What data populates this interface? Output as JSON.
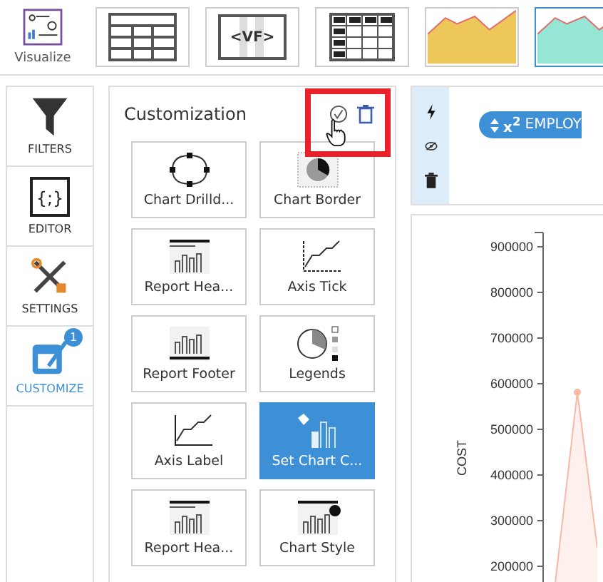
{
  "toolbar": {
    "visualize_label": "Visualize",
    "thumbnails": [
      {
        "kind": "table",
        "selected": false
      },
      {
        "kind": "vf",
        "text": "<VF>",
        "selected": false
      },
      {
        "kind": "grid",
        "selected": false
      },
      {
        "kind": "area",
        "color": "#eec75a",
        "selected": false
      },
      {
        "kind": "area",
        "color": "#96e6d6",
        "selected": true
      }
    ]
  },
  "sidebar": {
    "items": [
      {
        "kind": "filter",
        "label": "FILTERS",
        "selected": false
      },
      {
        "kind": "editor",
        "label": "EDITOR",
        "icon_text": "{;}",
        "selected": false
      },
      {
        "kind": "settings",
        "label": "SETTINGS",
        "selected": false
      },
      {
        "kind": "customize",
        "label": "CUSTOMIZE",
        "selected": true,
        "badge": "1"
      }
    ]
  },
  "customization": {
    "title": "Customization",
    "tiles": [
      {
        "kind": "drilldown",
        "label": "Chart Drilld...",
        "selected": false
      },
      {
        "kind": "border",
        "label": "Chart Border",
        "selected": false
      },
      {
        "kind": "report-header",
        "label": "Report Hea...",
        "selected": false
      },
      {
        "kind": "axis-tick",
        "label": "Axis Tick",
        "selected": false
      },
      {
        "kind": "report-footer",
        "label": "Report Footer",
        "selected": false
      },
      {
        "kind": "legends",
        "label": "Legends",
        "selected": false
      },
      {
        "kind": "axis-label",
        "label": "Axis Label",
        "selected": false
      },
      {
        "kind": "chart-color",
        "label": "Set Chart C...",
        "selected": true
      },
      {
        "kind": "report-header",
        "label": "Report Hea...",
        "selected": false
      },
      {
        "kind": "chart-style",
        "label": "Chart Style",
        "selected": false
      }
    ]
  },
  "field_bar": {
    "symbol": "x$^{2}$",
    "label": "EMPLOY"
  },
  "chart": {
    "y_axis_title": "COST",
    "y_tick_labels": [
      "900000",
      "800000",
      "700000",
      "600000",
      "500000",
      "400000",
      "300000",
      "200000"
    ]
  }
}
